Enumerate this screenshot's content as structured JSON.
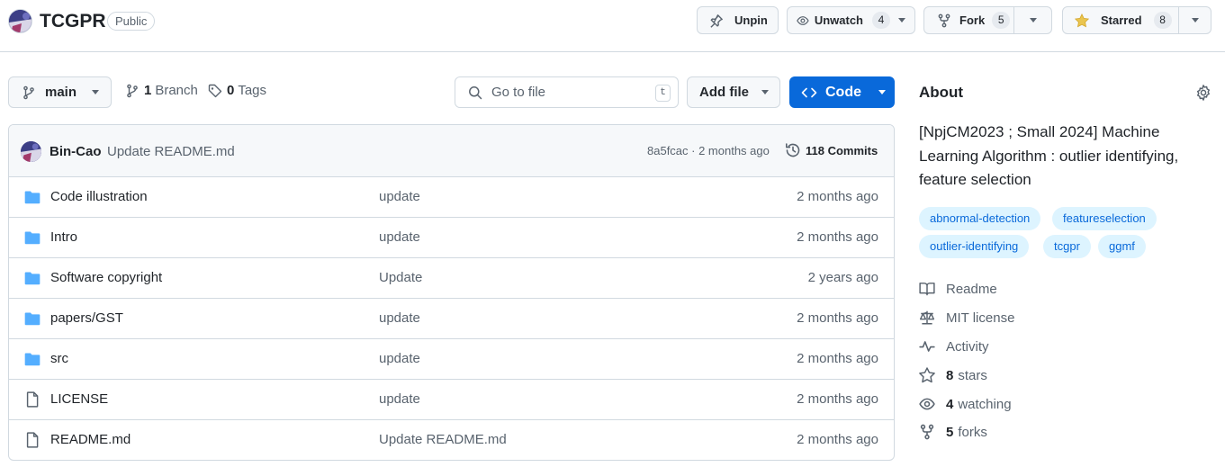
{
  "repo": {
    "name": "TCGPR",
    "visibility": "Public"
  },
  "actions": {
    "unpin_label": "Unpin",
    "unwatch_label": "Unwatch",
    "watch_count": "4",
    "fork_label": "Fork",
    "fork_count": "5",
    "starred_label": "Starred",
    "star_count": "8"
  },
  "toolbar": {
    "branch_name": "main",
    "branch_count": "1",
    "branch_label": "Branch",
    "tag_count": "0",
    "tag_label": "Tags",
    "search_placeholder": "Go to file",
    "search_shortcut": "t",
    "add_file_label": "Add file",
    "code_label": "Code"
  },
  "latest_commit": {
    "author": "Bin-Cao",
    "message": "Update README.md",
    "meta": "8a5fcac · 2 months ago",
    "commit_count_label": "118 Commits"
  },
  "files": [
    {
      "name": "Code illustration",
      "type": "folder",
      "message": "update",
      "date": "2 months ago"
    },
    {
      "name": "Intro",
      "type": "folder",
      "message": "update",
      "date": "2 months ago"
    },
    {
      "name": "Software copyright",
      "type": "folder",
      "message": "Update",
      "date": "2 years ago"
    },
    {
      "name": "papers/GST",
      "type": "folder",
      "message": "update",
      "date": "2 months ago"
    },
    {
      "name": "src",
      "type": "folder",
      "message": "update",
      "date": "2 months ago"
    },
    {
      "name": "LICENSE",
      "type": "file",
      "message": "update",
      "date": "2 months ago"
    },
    {
      "name": "README.md",
      "type": "file",
      "message": "Update README.md",
      "date": "2 months ago"
    }
  ],
  "about": {
    "title": "About",
    "description": "[NpjCM2023 ; Small 2024] Machine Learning Algorithm : outlier identifying, feature selection",
    "topics": [
      "abnormal-detection",
      "featureselection",
      "outlier-identifying",
      "tcgpr",
      "ggmf"
    ],
    "readme_label": "Readme",
    "license_label": "MIT license",
    "activity_label": "Activity",
    "stars_count": "8",
    "stars_label": "stars",
    "watching_count": "4",
    "watching_label": "watching",
    "forks_count": "5",
    "forks_label": "forks"
  },
  "colors": {
    "accent": "#0969da",
    "folder": "#54aeff",
    "star": "#eac54f",
    "topic_bg": "#ddf4ff"
  },
  "icons": [
    "repo-avatar",
    "pin-icon",
    "eye-icon",
    "fork-icon",
    "star-icon",
    "branch-icon",
    "tag-icon",
    "search-icon",
    "code-icon",
    "history-icon",
    "folder-icon",
    "file-icon",
    "gear-icon",
    "book-icon",
    "law-icon",
    "pulse-icon"
  ]
}
